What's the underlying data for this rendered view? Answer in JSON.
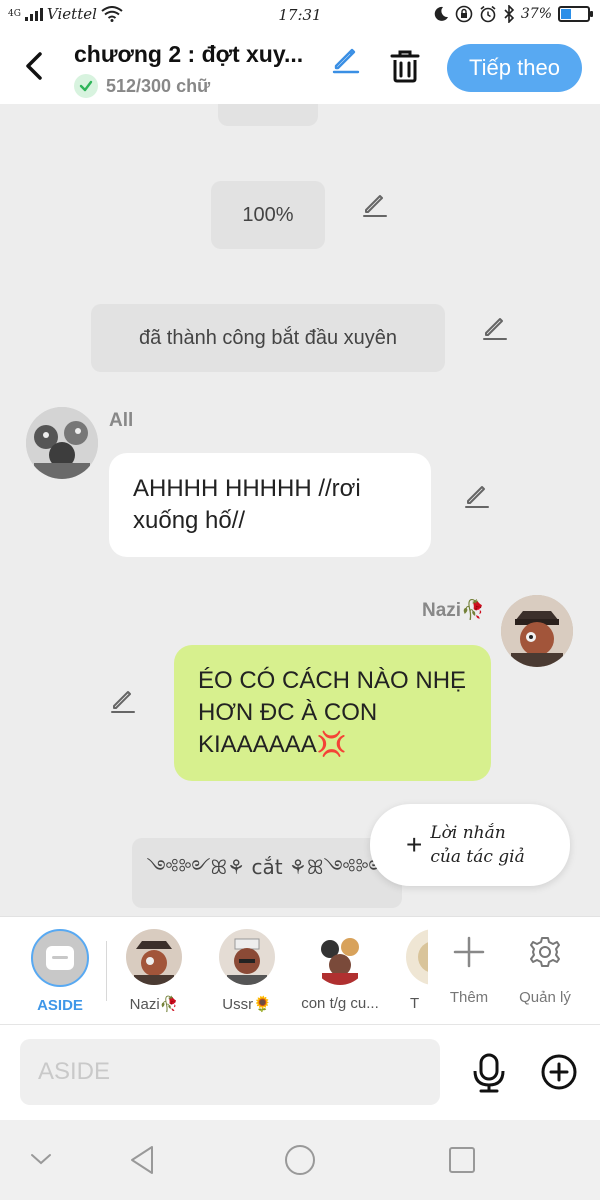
{
  "status_bar": {
    "signal": "4G",
    "carrier": "Viettel",
    "time": "17:31",
    "battery": "37%",
    "battery_level": 0.37
  },
  "header": {
    "title": "chương 2 : đợt xuy...",
    "word_count": "512/300 chữ",
    "next_label": "Tiếp theo",
    "accent_color": "#58a9f2"
  },
  "chat": {
    "aside_top_partial": "",
    "aside_percent": "100%",
    "aside_success": "đã thành công bắt đầu xuyên",
    "msg1": {
      "name": "All",
      "text": "AHHHH HHHHH //rơi xuống hố//"
    },
    "msg2": {
      "name": "Nazi🥀",
      "text": "ÉO CÓ CÁCH NÀO NHẸ HƠN ĐC À CON KIAAAAAA💢"
    },
    "aside_cut": "༺༻ꕤ⚘ cắt ⚘ꕤ༺༻",
    "author_note": {
      "line1": "Lời nhắn",
      "line2": "của tác giả"
    }
  },
  "characters": [
    {
      "label": "ASIDE"
    },
    {
      "label": "Nazi🥀"
    },
    {
      "label": "Ussr🌻"
    },
    {
      "label": "con t/g cu..."
    },
    {
      "label": "T"
    }
  ],
  "tools": {
    "add": "Thêm",
    "manage": "Quản lý"
  },
  "input": {
    "placeholder": "ASIDE"
  }
}
